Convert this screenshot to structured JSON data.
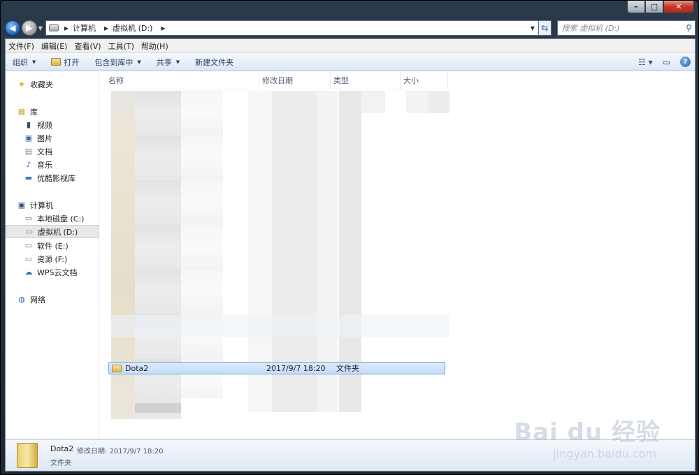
{
  "window": {
    "caption_min": "–",
    "caption_max": "□",
    "caption_close": "✕"
  },
  "address": {
    "crumbs": [
      "计算机",
      "虚拟机 (D:)"
    ],
    "search_placeholder": "搜索 虚拟机 (D:)"
  },
  "menu": [
    "文件(F)",
    "编辑(E)",
    "查看(V)",
    "工具(T)",
    "帮助(H)"
  ],
  "toolbar": {
    "organize": "组织",
    "open": "打开",
    "include": "包含到库中",
    "share": "共享",
    "new_folder": "新建文件夹"
  },
  "nav": {
    "favorites": "收藏夹",
    "libraries": "库",
    "lib_items": [
      "视频",
      "图片",
      "文档",
      "音乐",
      "优酷影视库"
    ],
    "computer": "计算机",
    "drives": [
      "本地磁盘 (C:)",
      "虚拟机 (D:)",
      "软件 (E:)",
      "资源 (F:)",
      "WPS云文档"
    ],
    "network": "网络"
  },
  "columns": {
    "name": "名称",
    "modified": "修改日期",
    "type": "类型",
    "size": "大小"
  },
  "selected_row": {
    "name": "Dota2",
    "modified": "2017/9/7 18:20",
    "type": "文件夹"
  },
  "details": {
    "name": "Dota2",
    "meta_label": "修改日期:",
    "meta_value": "2017/9/7 18:20",
    "type": "文件夹"
  },
  "watermark": {
    "brand": "Bai du 经验",
    "url": "jingyan.baidu.com"
  }
}
